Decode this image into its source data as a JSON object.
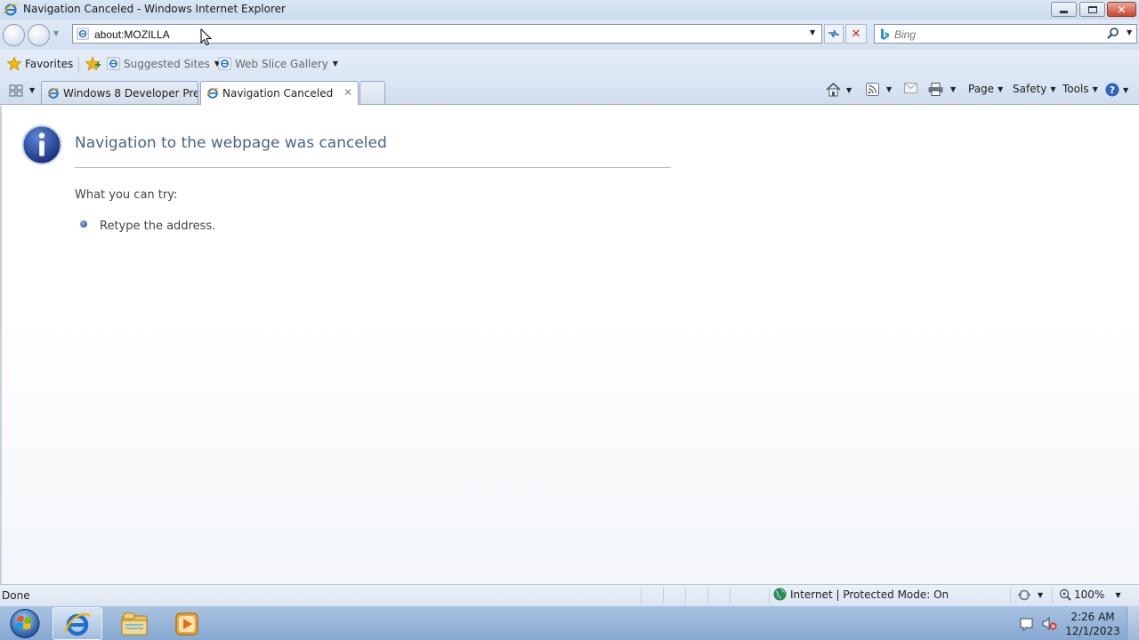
{
  "window": {
    "title": "Navigation Canceled - Windows Internet Explorer",
    "icon": "ie-icon"
  },
  "address_bar": {
    "value": "about:MOZILLA"
  },
  "search": {
    "placeholder": "Bing"
  },
  "favorites_bar": {
    "favorites_label": "Favorites",
    "items": [
      {
        "label": "Suggested Sites"
      },
      {
        "label": "Web Slice Gallery"
      }
    ]
  },
  "tabs": [
    {
      "label": "Windows 8 Developer Prev...",
      "active": false
    },
    {
      "label": "Navigation Canceled",
      "active": true
    }
  ],
  "command_bar": {
    "page_label": "Page",
    "safety_label": "Safety",
    "tools_label": "Tools"
  },
  "page": {
    "heading": "Navigation to the webpage was canceled",
    "try_label": "What you can try:",
    "suggestions": [
      "Retype the address."
    ]
  },
  "status_bar": {
    "status": "Done",
    "zone": "Internet | Protected Mode: On",
    "zoom": "100%"
  },
  "taskbar": {
    "time": "2:26 AM",
    "date": "12/1/2023"
  },
  "colors": {
    "heading": "#4b6287",
    "chrome": "#dbe6f4",
    "taskbar": "#9ab6da"
  }
}
